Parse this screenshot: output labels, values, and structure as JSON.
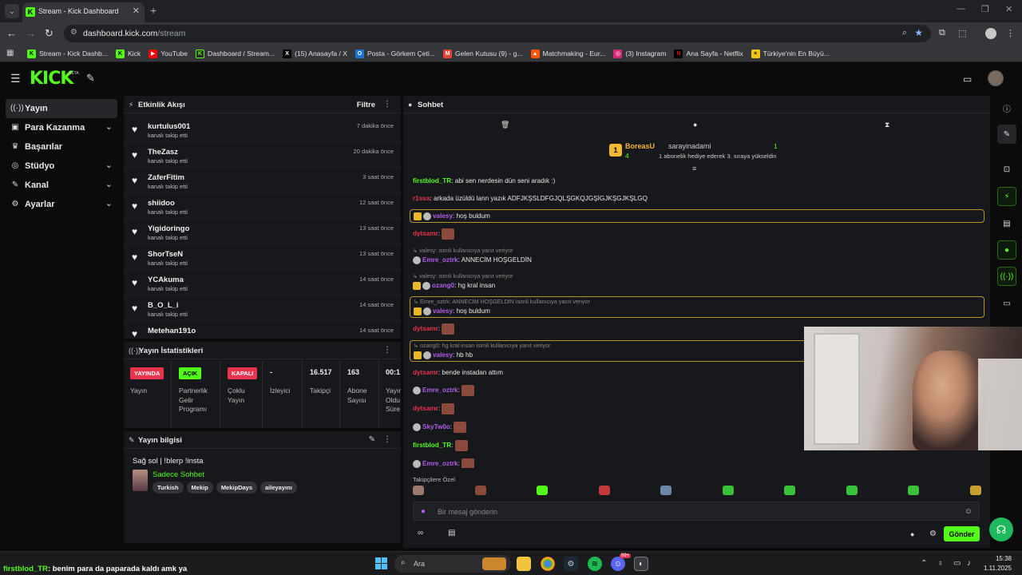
{
  "browser": {
    "tab_title": "Stream - Kick Dashboard",
    "url_host": "dashboard.kick.com",
    "url_path": "/stream",
    "bookmarks": [
      {
        "label": "Stream - Kick Dashb...",
        "icon": "kick-icon",
        "color": "#53fc18"
      },
      {
        "label": "Kick",
        "icon": "kick-icon",
        "color": "#53fc18"
      },
      {
        "label": "YouTube",
        "icon": "youtube-icon",
        "color": "#ff0000"
      },
      {
        "label": "Dashboard / Stream...",
        "icon": "kick-dashboard-icon",
        "color": "#53fc18"
      },
      {
        "label": "(15) Anasayfa / X",
        "icon": "x-icon",
        "color": "#000000"
      },
      {
        "label": "Posta - Görkem Çeti...",
        "icon": "outlook-icon",
        "color": "#1976d2"
      },
      {
        "label": "Gelen Kutusu (9) - g...",
        "icon": "gmail-icon",
        "color": "#ea4335"
      },
      {
        "label": "Matchmaking - Eur...",
        "icon": "faceit-icon",
        "color": "#ff5500"
      },
      {
        "label": "(3) Instagram",
        "icon": "instagram-icon",
        "color": "#d62976"
      },
      {
        "label": "Ana Sayfa - Netflix",
        "icon": "netflix-icon",
        "color": "#e50914"
      },
      {
        "label": "Türkiye'nin En Büyü...",
        "icon": "site-icon",
        "color": "#f5c518"
      }
    ]
  },
  "colors": {
    "brand": "#53fc18",
    "gold": "#f3b830",
    "bg": "#0b0b0c",
    "panel": "#17181b"
  },
  "sidebar": {
    "items": [
      {
        "label": "Yayın",
        "icon": "broadcast-icon",
        "active": true
      },
      {
        "label": "Para Kazanma",
        "icon": "money-icon",
        "chevron": true
      },
      {
        "label": "Başarılar",
        "icon": "trophy-icon"
      },
      {
        "label": "Stüdyo",
        "icon": "studio-icon",
        "chevron": true
      },
      {
        "label": "Kanal",
        "icon": "channel-icon",
        "chevron": true
      },
      {
        "label": "Ayarlar",
        "icon": "gear-icon",
        "chevron": true
      }
    ]
  },
  "activity": {
    "title": "Etkinlik Akışı",
    "filter_label": "Filtre",
    "items": [
      {
        "user": "kurtulus001",
        "desc": "kanalı takip etti",
        "time": "7 dakika önce"
      },
      {
        "user": "TheZasz",
        "desc": "kanalı takip etti",
        "time": "20 dakika önce"
      },
      {
        "user": "ZaferFitim",
        "desc": "kanalı takip etti",
        "time": "3 saat önce"
      },
      {
        "user": "shiidoo",
        "desc": "kanalı takip etti",
        "time": "12 saat önce"
      },
      {
        "user": "Yigidoringo",
        "desc": "kanalı takip etti",
        "time": "13 saat önce"
      },
      {
        "user": "ShorTseN",
        "desc": "kanalı takip etti",
        "time": "13 saat önce"
      },
      {
        "user": "YCAkuma",
        "desc": "kanalı takip etti",
        "time": "14 saat önce"
      },
      {
        "user": "B_O_L_i",
        "desc": "kanalı takip etti",
        "time": "14 saat önce"
      },
      {
        "user": "Metehan191o",
        "desc": "",
        "time": "14 saat önce"
      }
    ]
  },
  "stats": {
    "title": "Yayın İstatistikleri",
    "items": [
      {
        "badge": "YAYINDA",
        "label": "Yayın"
      },
      {
        "badge": "AÇIK",
        "label": "Partnerlik Gelir Programı"
      },
      {
        "badge": "KAPALI",
        "label": "Çoklu Yayın"
      },
      {
        "value": "-",
        "label": "İzleyici"
      },
      {
        "value": "16.517",
        "label": "Takipçi"
      },
      {
        "value": "163",
        "label": "Abone Sayısı"
      },
      {
        "value": "00:1",
        "label": "Yayın Oldu Süre"
      }
    ]
  },
  "stream_info": {
    "title": "Yayın bilgisi",
    "stream_title": "Sağ sol | !blerp !insta",
    "category": "Sadece Sohbet",
    "tags": [
      "Turkish",
      "Mekip",
      "MekipDays",
      "aileyayını"
    ]
  },
  "chat": {
    "title": "Sohbet",
    "pinned": {
      "gifter": "BoreasU",
      "gifter_count": "4",
      "recipient": "sarayinadami",
      "recipient_count": "1",
      "text": "1 abonelik hediye ederek 3. sıraya yükseldin"
    },
    "messages": [
      {
        "user": "firstblod_TR",
        "color": "#53fc18",
        "text": "abi sen nerdesin dün seni aradık :)"
      },
      {
        "user": "r1ssa",
        "color": "#e8344e",
        "text": "arkada üzüldü lann yazık ADFJKŞSLDFGJQLŞGKQJGŞİGJKŞGJKŞLGQ"
      },
      {
        "user": "valesy",
        "color": "#b05ce8",
        "text": "hoş buldum",
        "highlight": true,
        "badges": 2
      },
      {
        "user": "dytsamr",
        "color": "#e8344e",
        "text": "",
        "emote": true
      },
      {
        "reply": "valesy: isimli kullanıcıya yanıt veriyor",
        "user": "Emre_oztrk",
        "color": "#b05ce8",
        "text": "ANNECİM HOŞGELDİN",
        "badges": 1
      },
      {
        "reply": "valesy: isimli kullanıcıya yanıt veriyor",
        "user": "ozang0",
        "color": "#b05ce8",
        "text": "hg kral insan",
        "badges": 2
      },
      {
        "reply": "Emre_oztrk: ANNECİM HOŞGELDİN isimli kullanıcıya yanıt veriyor",
        "user": "valesy",
        "color": "#b05ce8",
        "text": "hoş buldum",
        "highlight": true,
        "badges": 2
      },
      {
        "user": "dytsamr",
        "color": "#e8344e",
        "text": "",
        "emote": true
      },
      {
        "reply": "ozang0: hg kral insan isimli kullanıcıya yanıt veriyor",
        "user": "valesy",
        "color": "#b05ce8",
        "text": "hb hb",
        "highlight": true,
        "badges": 2
      },
      {
        "user": "dytsamr",
        "color": "#e8344e",
        "text": "bende instadan attım"
      },
      {
        "user": "Emre_oztrk",
        "color": "#b05ce8",
        "text": "",
        "emote": true,
        "badges": 1
      },
      {
        "user": "dytsamr",
        "color": "#e8344e",
        "text": "",
        "emote": true
      },
      {
        "user": "SkyTw0o",
        "color": "#b05ce8",
        "text": "",
        "emote": true,
        "badges": 1
      },
      {
        "user": "firstblod_TR",
        "color": "#53fc18",
        "text": "",
        "emote": true
      },
      {
        "user": "Emre_oztrk",
        "color": "#b05ce8",
        "text": "",
        "emote": true,
        "badges": 1
      },
      {
        "user": "dytsamr",
        "color": "#e8344e",
        "text": "",
        "emote": true
      },
      {
        "user": "SkyTw0o",
        "color": "#b05ce8",
        "text": "kontörü bitmiş",
        "badges": 1
      },
      {
        "user": "firstblod_TR",
        "color": "#53fc18",
        "text": "benim para da paparada kaldı amk ya"
      }
    ],
    "followers_only_label": "Takipçilere Özel",
    "input_placeholder": "Bir mesaj gönderin",
    "send_label": "Gönder"
  },
  "taskbar": {
    "overlay_user": "firstblod_TR",
    "overlay_text": ": benim para da paparada kaldı amk ya",
    "search_label": "Ara",
    "time": "15:38",
    "date": "1.11.2025",
    "discord_badge": "99+"
  }
}
